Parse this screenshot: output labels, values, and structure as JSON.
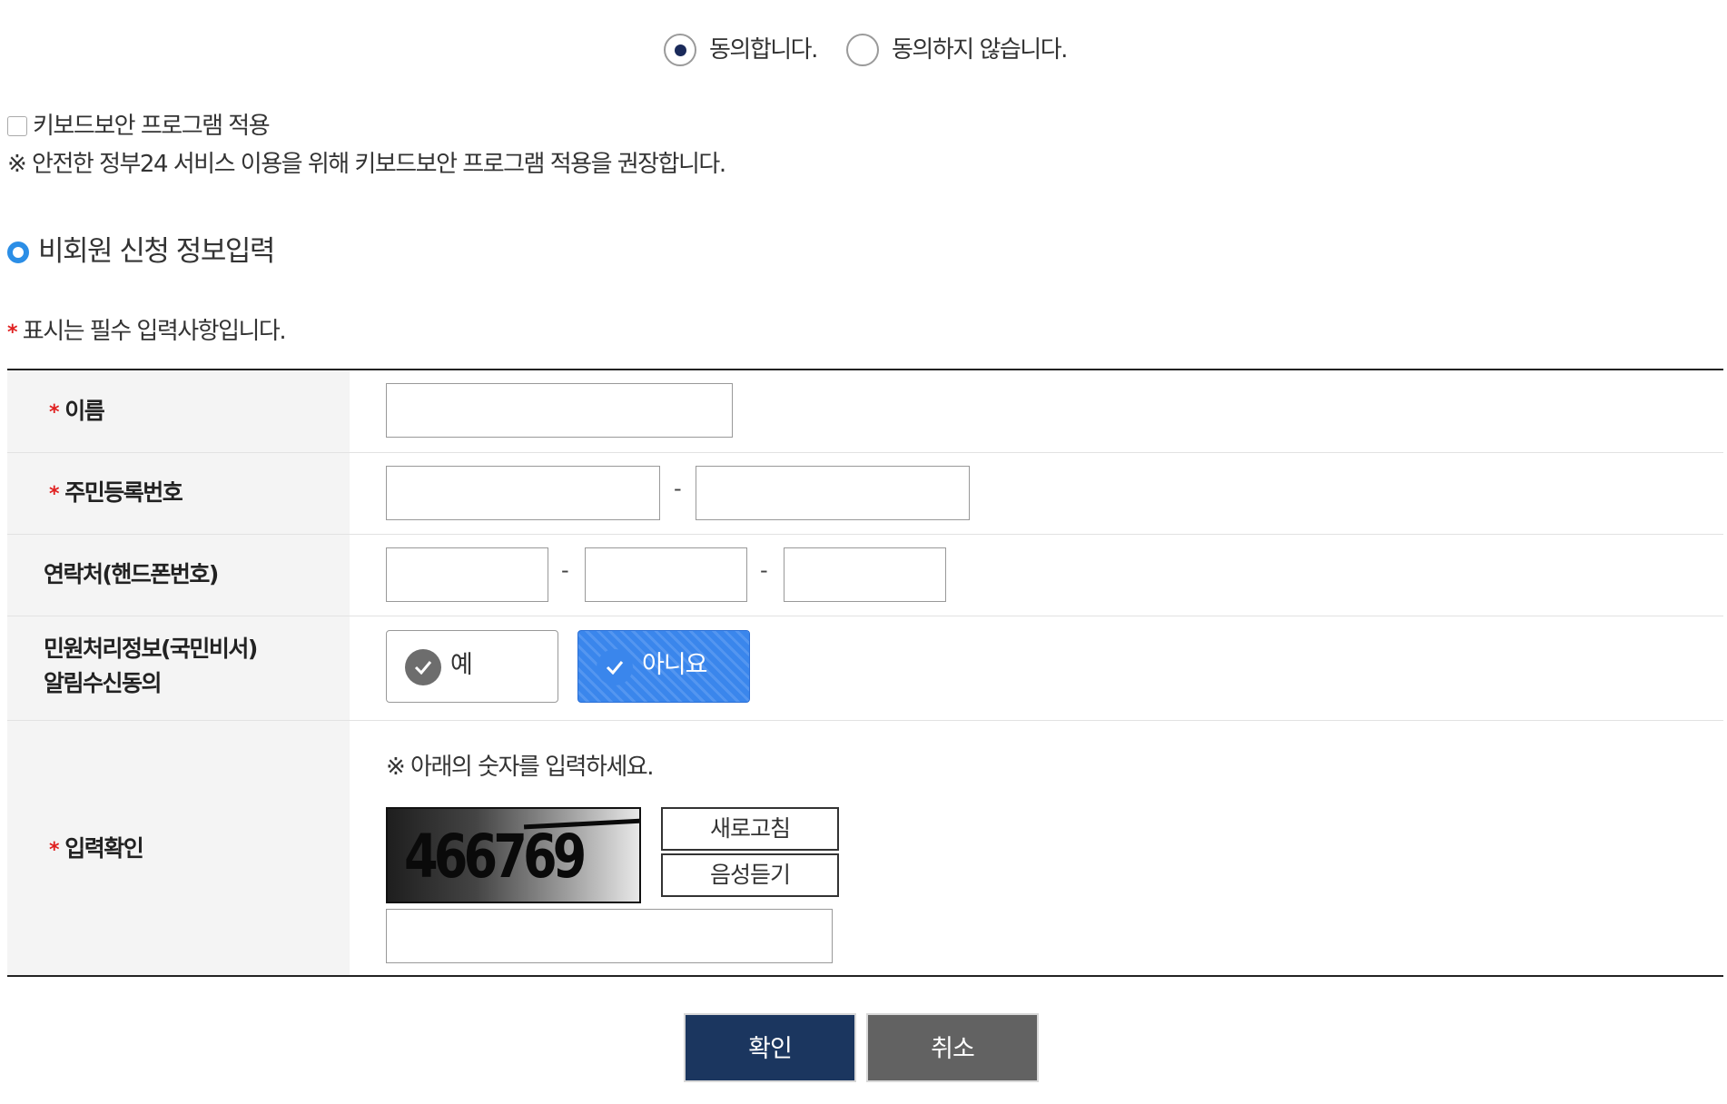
{
  "consent": {
    "agree_label": "동의합니다.",
    "disagree_label": "동의하지 않습니다.",
    "selected": "agree"
  },
  "keyboard_security": {
    "checkbox_label": "키보드보안 프로그램 적용",
    "checked": false,
    "notice": "※ 안전한 정부24 서비스 이용을 위해 키보드보안 프로그램 적용을 권장합니다."
  },
  "section": {
    "title": "비회원 신청 정보입력",
    "required_note": "표시는 필수 입력사항입니다.",
    "required_mark": "*"
  },
  "form": {
    "name": {
      "label": "이름",
      "required": true,
      "value": ""
    },
    "resident_number": {
      "label": "주민등록번호",
      "required": true,
      "part1": "",
      "part2": "",
      "separator": "-"
    },
    "phone": {
      "label": "연락처(핸드폰번호)",
      "required": false,
      "part1": "",
      "part2": "",
      "part3": "",
      "separator": "-"
    },
    "notification_consent": {
      "label_line1": "민원처리정보(국민비서)",
      "label_line2": "알림수신동의",
      "yes_label": "예",
      "no_label": "아니요",
      "selected": "no"
    },
    "captcha": {
      "label": "입력확인",
      "required": true,
      "instruction": "※ 아래의 숫자를 입력하세요.",
      "image_text": "466769",
      "refresh_label": "새로고침",
      "audio_label": "음성듣기",
      "value": ""
    }
  },
  "actions": {
    "confirm_label": "확인",
    "cancel_label": "취소"
  },
  "colors": {
    "primary_navy": "#1b365f",
    "cancel_gray": "#626262",
    "selected_blue": "#3a86ec",
    "required_red": "#e02020",
    "section_icon_blue": "#2b8ee6"
  }
}
